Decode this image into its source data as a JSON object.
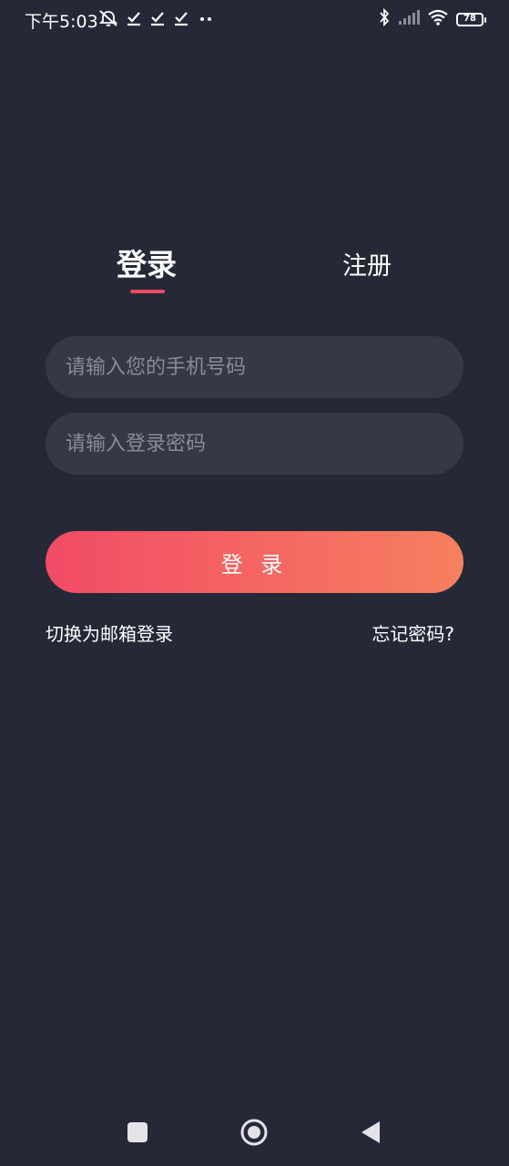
{
  "status_bar": {
    "time": "下午5:03",
    "battery_level": "78",
    "icons_left": [
      "mute-notification-icon",
      "check-icon",
      "check-icon",
      "check-icon",
      "more-dots-icon"
    ],
    "icons_right": [
      "bluetooth-icon",
      "signal-icon",
      "wifi-icon",
      "battery-icon"
    ]
  },
  "tabs": {
    "login_label": "登录",
    "register_label": "注册",
    "active": "login"
  },
  "form": {
    "phone_placeholder": "请输入您的手机号码",
    "phone_value": "",
    "password_placeholder": "请输入登录密码",
    "password_value": ""
  },
  "login_button_label": "登 录",
  "links": {
    "switch_to_email": "切换为邮箱登录",
    "forgot_password": "忘记密码?"
  },
  "colors": {
    "background": "#252937",
    "input_background": "#353945",
    "accent": "#ee4a62",
    "button_gradient_start": "#f24b66",
    "button_gradient_end": "#f6805f"
  },
  "nav_bar": {
    "buttons": [
      "recent-apps-icon",
      "home-icon",
      "back-icon"
    ]
  }
}
